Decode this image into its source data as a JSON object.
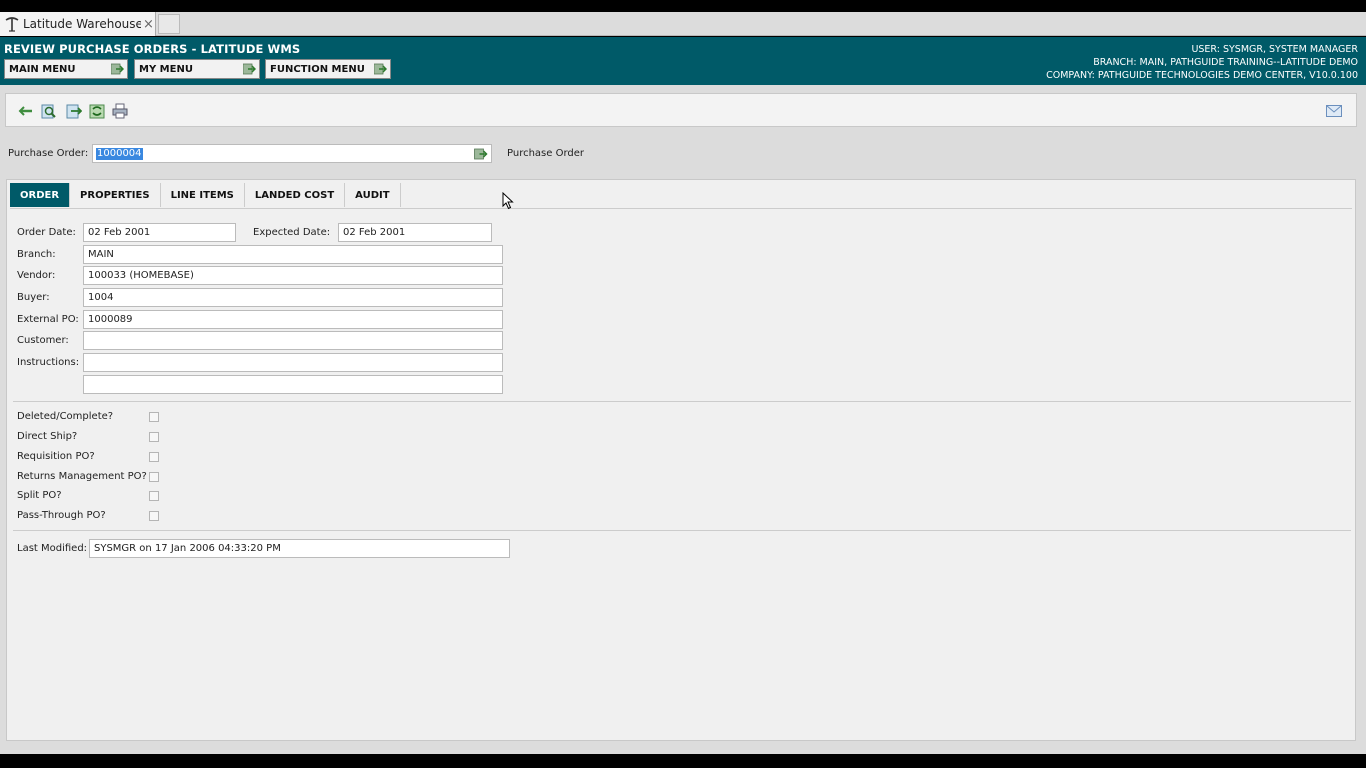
{
  "browser": {
    "tab_title": "Latitude Warehouse...",
    "close_glyph": "×"
  },
  "header": {
    "title": "REVIEW PURCHASE ORDERS - LATITUDE WMS",
    "user": "USER: SYSMGR, SYSTEM MANAGER",
    "branch": "BRANCH: MAIN, PATHGUIDE TRAINING--LATITUDE DEMO",
    "company": "COMPANY: PATHGUIDE TECHNOLOGIES DEMO CENTER, V10.0.100",
    "menus": [
      {
        "label": "MAIN MENU"
      },
      {
        "label": "MY MENU"
      },
      {
        "label": "FUNCTION MENU"
      }
    ]
  },
  "toolbar": {
    "icons": [
      "back-arrow-icon",
      "find-icon",
      "export-icon",
      "refresh-icon",
      "print-icon",
      "mail-icon"
    ]
  },
  "lookup": {
    "label": "Purchase Order:",
    "value": "1000004",
    "description": "Purchase Order"
  },
  "tabs": [
    {
      "label": "ORDER",
      "active": true
    },
    {
      "label": "PROPERTIES",
      "active": false
    },
    {
      "label": "LINE ITEMS",
      "active": false
    },
    {
      "label": "LANDED COST",
      "active": false
    },
    {
      "label": "AUDIT",
      "active": false
    }
  ],
  "order": {
    "order_date_label": "Order Date:",
    "order_date": "02 Feb 2001",
    "expected_date_label": "Expected Date:",
    "expected_date": "02 Feb 2001",
    "branch_label": "Branch:",
    "branch": "MAIN",
    "vendor_label": "Vendor:",
    "vendor": "100033 (HOMEBASE)",
    "buyer_label": "Buyer:",
    "buyer": "1004",
    "external_po_label": "External PO:",
    "external_po": "1000089",
    "customer_label": "Customer:",
    "customer": "",
    "instructions_label": "Instructions:",
    "instructions_1": "",
    "instructions_2": ""
  },
  "flags": [
    {
      "label": "Deleted/Complete?",
      "checked": false
    },
    {
      "label": "Direct Ship?",
      "checked": false
    },
    {
      "label": "Requisition PO?",
      "checked": false
    },
    {
      "label": "Returns Management PO?",
      "checked": false
    },
    {
      "label": "Split PO?",
      "checked": false
    },
    {
      "label": "Pass-Through PO?",
      "checked": false
    }
  ],
  "modified": {
    "label": "Last Modified:",
    "value": "SYSMGR on 17 Jan 2006 04:33:20 PM"
  },
  "colors": {
    "header_bg": "#005a68",
    "active_tab_bg": "#005a68",
    "selection": "#3a88e0"
  }
}
